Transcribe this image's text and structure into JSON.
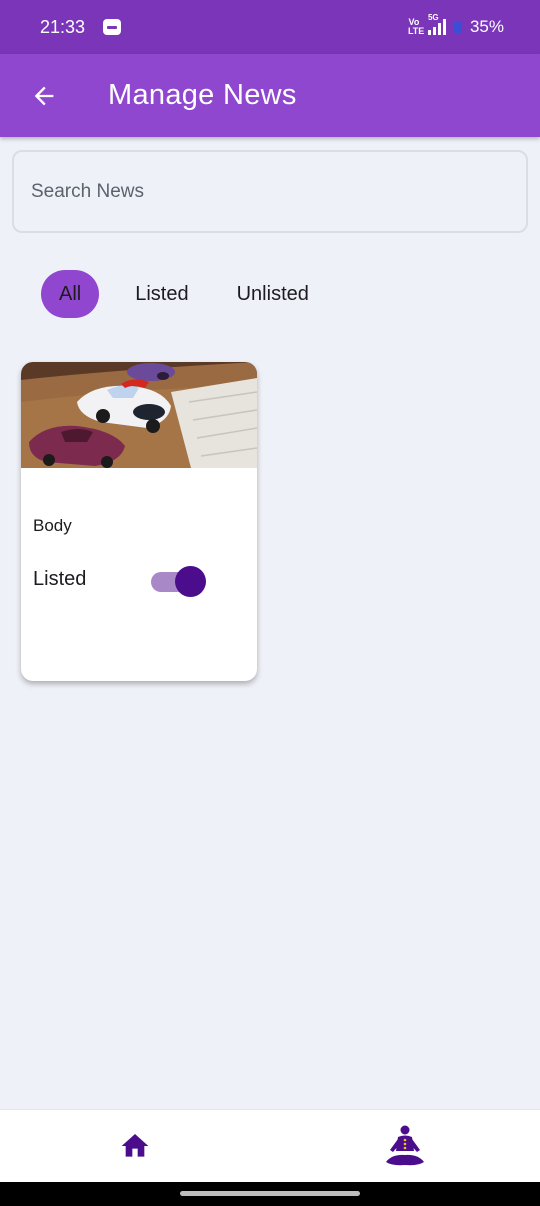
{
  "status_bar": {
    "time": "21:33",
    "battery": "35%",
    "network": "5G",
    "volte": "Vo LTE",
    "notification_icon": "app-notification-icon"
  },
  "app_bar": {
    "title": "Manage News",
    "back_icon": "arrow-left-icon",
    "color": "#8f47cf"
  },
  "search": {
    "placeholder": "Search News",
    "value": ""
  },
  "filters": {
    "options": [
      "All",
      "Listed",
      "Unlisted"
    ],
    "selected": "All",
    "accent": "#9146d0"
  },
  "news": [
    {
      "image": "toy-cars-photo",
      "body": "Body",
      "status_label": "Listed",
      "listed": true
    }
  ],
  "bottom_nav": {
    "items": [
      "home-icon",
      "meditation-icon"
    ],
    "color": "#4b0d8c"
  }
}
